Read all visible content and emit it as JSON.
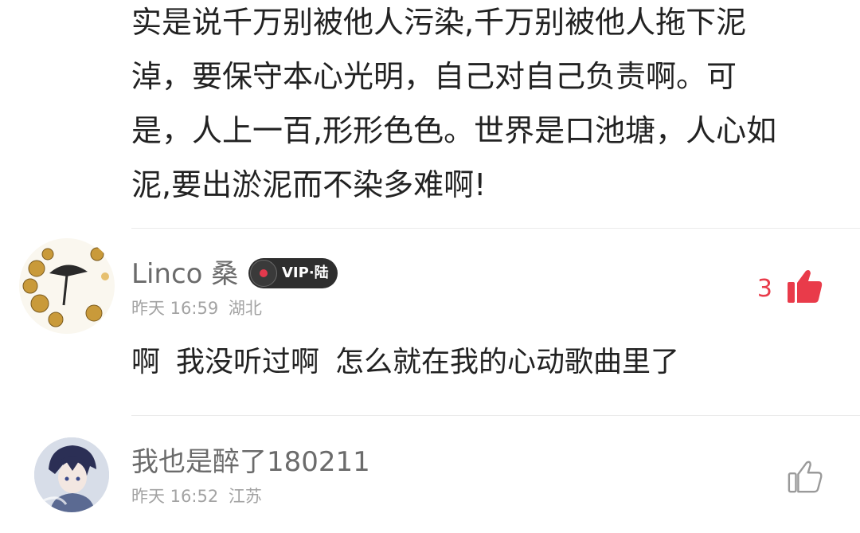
{
  "top_comment": {
    "lines": [
      "实是说千万别被他人污染,千万别被他人拖下泥",
      "淖，要保守本心光明，自己对自己负责啊。可",
      "是，人上一百,形形色色。世界是口池塘，人心如",
      "泥,要出淤泥而不染多难啊!"
    ]
  },
  "comments": [
    {
      "username": "Linco 桑",
      "vip_badge": "VIP·陆",
      "time": "昨天 16:59",
      "location": "湖北",
      "likes": "3",
      "text_parts": [
        "啊",
        "我没听过啊",
        "怎么就在我的心动歌曲里了"
      ],
      "like_color": "#e93b4a"
    },
    {
      "username": "我也是醉了180211",
      "time": "昨天 16:52",
      "location": "江苏",
      "like_color": "#9a9a9a"
    }
  ],
  "icons": [
    "avatar",
    "vinyl-disc-icon",
    "thumbs-up-icon"
  ]
}
